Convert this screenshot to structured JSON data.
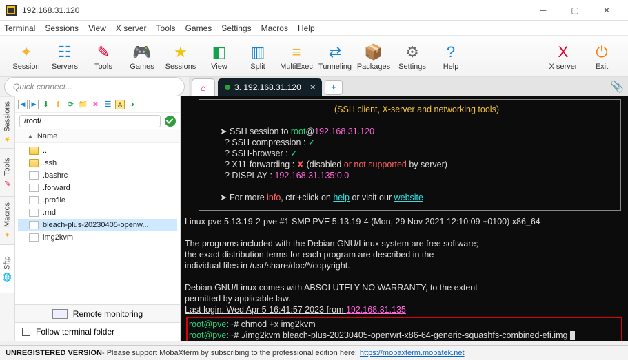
{
  "window": {
    "title": "192.168.31.120"
  },
  "menu": [
    "Terminal",
    "Sessions",
    "View",
    "X server",
    "Tools",
    "Games",
    "Settings",
    "Macros",
    "Help"
  ],
  "toolbar": [
    {
      "label": "Session",
      "color": "#f9b233",
      "glyph": "✦"
    },
    {
      "label": "Servers",
      "color": "#1a84d6",
      "glyph": "☷"
    },
    {
      "label": "Tools",
      "color": "#e1002d",
      "glyph": "✎"
    },
    {
      "label": "Games",
      "color": "#8a8a8a",
      "glyph": "🎮"
    },
    {
      "label": "Sessions",
      "color": "#f4c20d",
      "glyph": "★"
    },
    {
      "label": "View",
      "color": "#17a04c",
      "glyph": "◧"
    },
    {
      "label": "Split",
      "color": "#1a84d6",
      "glyph": "▥"
    },
    {
      "label": "MultiExec",
      "color": "#f9b233",
      "glyph": "≡"
    },
    {
      "label": "Tunneling",
      "color": "#1a84d6",
      "glyph": "⇄"
    },
    {
      "label": "Packages",
      "color": "#c9842c",
      "glyph": "📦"
    },
    {
      "label": "Settings",
      "color": "#6a6a6a",
      "glyph": "⚙"
    },
    {
      "label": "Help",
      "color": "#1a84d6",
      "glyph": "?"
    }
  ],
  "toolbar_right": [
    {
      "label": "X server",
      "color": "#e1002d",
      "glyph": "X"
    },
    {
      "label": "Exit",
      "color": "#ff7b00",
      "glyph": "⏻"
    }
  ],
  "quick": {
    "placeholder": "Quick connect..."
  },
  "tab": {
    "label": "3. 192.168.31.120"
  },
  "sidetabs": [
    "Sessions",
    "Tools",
    "Macros",
    "Sftp"
  ],
  "sftp": {
    "path": "/root/",
    "header": "Name",
    "files": [
      {
        "name": "..",
        "type": "folder"
      },
      {
        "name": ".ssh",
        "type": "folder"
      },
      {
        "name": ".bashrc",
        "type": "file"
      },
      {
        "name": ".forward",
        "type": "file"
      },
      {
        "name": ".profile",
        "type": "file"
      },
      {
        "name": ".rnd",
        "type": "file"
      },
      {
        "name": "bleach-plus-20230405-openw...",
        "type": "file",
        "selected": true
      },
      {
        "name": "img2kvm",
        "type": "file"
      }
    ],
    "remote_monitoring": "Remote monitoring",
    "follow": "Follow terminal folder"
  },
  "term": {
    "banner": "(SSH client, X-server and networking tools)",
    "sess_label": "SSH session to ",
    "sess_user": "root",
    "sess_at": "@",
    "sess_host": "192.168.31.120",
    "l1a": "? SSH compression : ",
    "l2a": "? SSH-browser     : ",
    "l3a": "? X11-forwarding  : ",
    "l3b": "  (disabled ",
    "l3c": "or ",
    "l3d": "not supported ",
    "l3e": "by server)",
    "l4a": "? DISPLAY         : ",
    "l4b": "192.168.31.135:0.0",
    "info1": "➤ For more ",
    "info2": "info",
    "info3": ", ctrl+click on ",
    "info4": "help",
    "info5": " or visit our ",
    "info6": "website",
    "body1": "Linux pve 5.13.19-2-pve #1 SMP PVE 5.13.19-4 (Mon, 29 Nov 2021 12:10:09 +0100) x86_64",
    "body2": "The programs included with the Debian GNU/Linux system are free software;",
    "body3": "the exact distribution terms for each program are described in the",
    "body4": "individual files in /usr/share/doc/*/copyright.",
    "body5": "Debian GNU/Linux comes with ABSOLUTELY NO WARRANTY, to the extent",
    "body6": "permitted by applicable law.",
    "last1": "Last login: Wed Apr  5 16:41:57 2023 from ",
    "last2": "192.168.31.135",
    "p1a": "root@pve",
    "p1b": ":",
    "p1c": "~",
    "p1d": "# chmod +x img2kvm",
    "p2a": "root@pve",
    "p2b": ":",
    "p2c": "~",
    "p2d": "# ./img2kvm bleach-plus-20230405-openwrt-x86-64-generic-squashfs-combined-efi.img "
  },
  "status": {
    "left": "UNREGISTERED VERSION",
    "mid": " - Please support MobaXterm by subscribing to the professional edition here: ",
    "link": "https://mobaxterm.mobatek.net"
  }
}
